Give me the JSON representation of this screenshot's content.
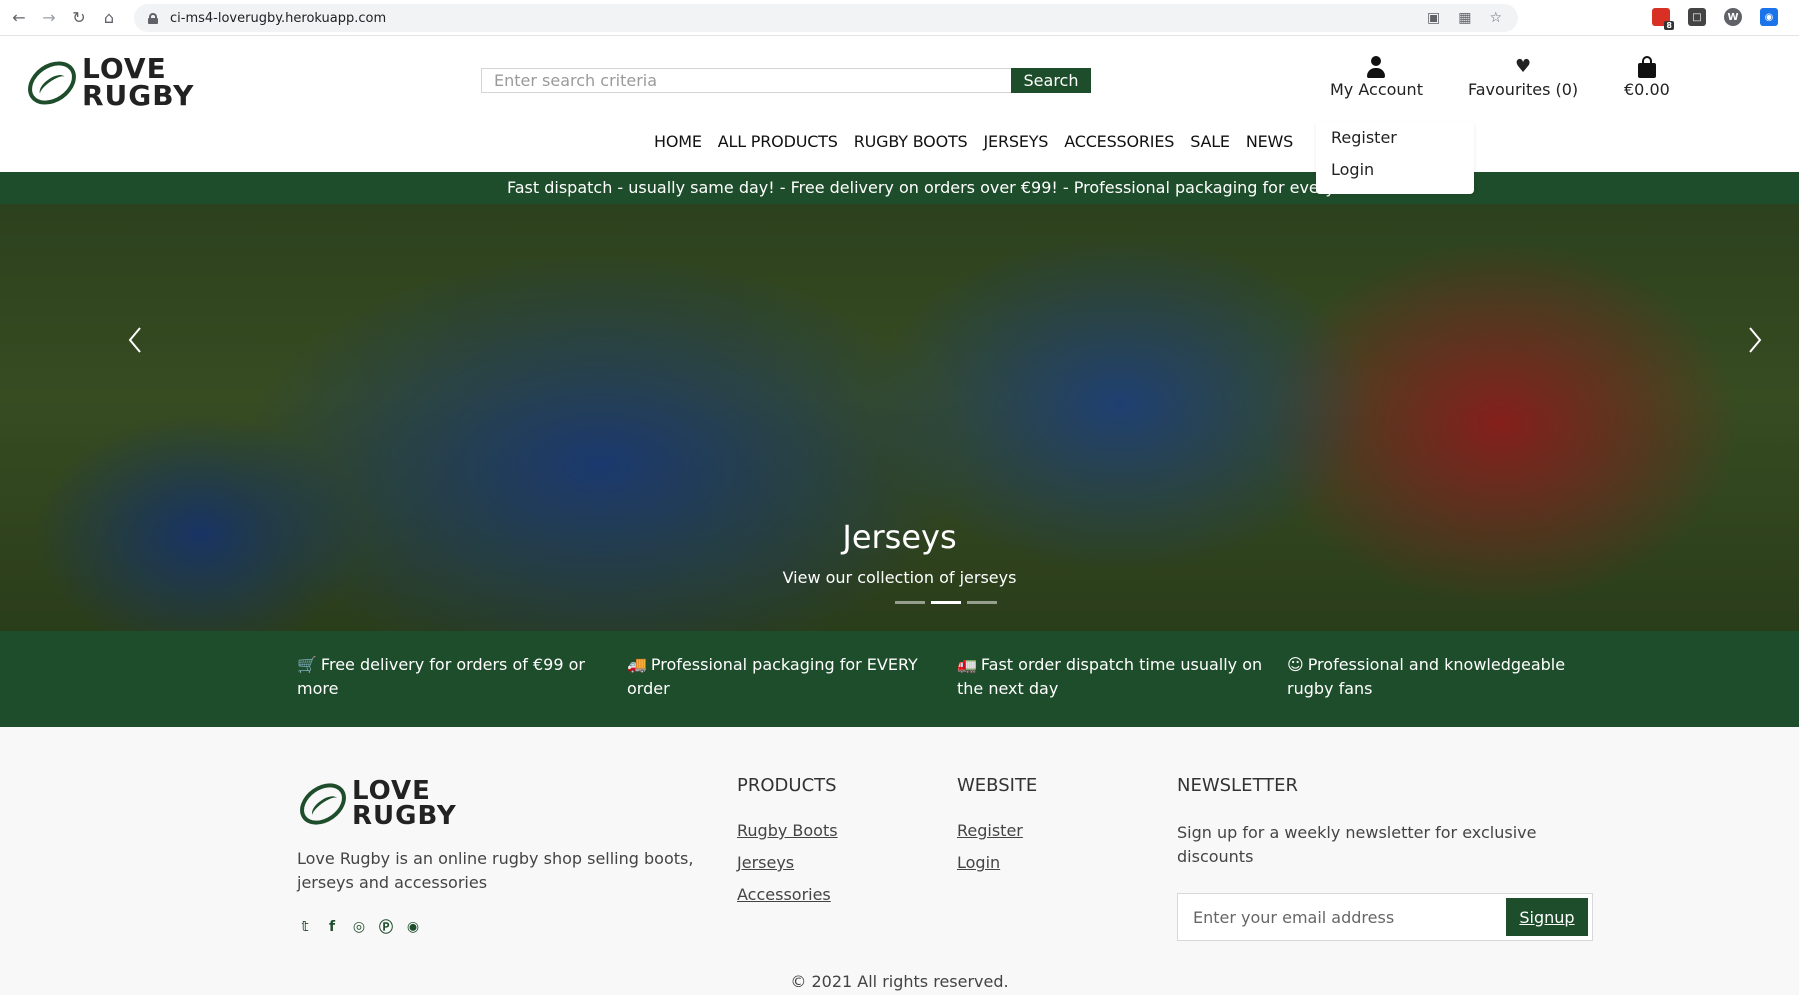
{
  "browser": {
    "url": "ci-ms4-loverugby.herokuapp.com",
    "extension_badge": "8"
  },
  "logo": {
    "line1": "LOVE",
    "line2": "RUGBY"
  },
  "search": {
    "placeholder": "Enter search criteria",
    "button_label": "Search"
  },
  "account": {
    "my_account": "My Account",
    "favourites": "Favourites (0)",
    "cart_total": "€0.00",
    "dropdown": [
      "Register",
      "Login"
    ]
  },
  "nav": [
    "HOME",
    "ALL PRODUCTS",
    "RUGBY BOOTS",
    "JERSEYS",
    "ACCESSORIES",
    "SALE",
    "NEWS"
  ],
  "banner": {
    "text": "Fast dispatch - usually same day! - Free delivery on orders over €99! - Professional packaging for every order!"
  },
  "hero": {
    "title": "Jerseys",
    "subtitle": "View our collection of jerseys",
    "slide_count": 3,
    "active_slide": 2
  },
  "features": [
    {
      "icon": "cart-icon",
      "text": "Free delivery for orders of €99 or more"
    },
    {
      "icon": "box-icon",
      "text": "Professional packaging for EVERY order"
    },
    {
      "icon": "truck-icon",
      "text": "Fast order dispatch time usually on the next day"
    },
    {
      "icon": "smile-icon",
      "text": "Professional and knowledgeable rugby fans"
    }
  ],
  "footer": {
    "description": "Love Rugby is an online rugby shop selling boots, jerseys and accessories",
    "products_title": "PRODUCTS",
    "products_links": [
      "Rugby Boots",
      "Jerseys",
      "Accessories"
    ],
    "website_title": "WEBSITE",
    "website_links": [
      "Register",
      "Login"
    ],
    "newsletter_title": "NEWSLETTER",
    "newsletter_text": "Sign up for a weekly newsletter for exclusive discounts",
    "email_placeholder": "Enter your email address",
    "signup_label": "Signup",
    "copyright": "© 2021 All rights reserved.",
    "social_icons": [
      "twitter-icon",
      "facebook-icon",
      "instagram-icon",
      "pinterest-icon",
      "snapchat-icon"
    ]
  },
  "colors": {
    "brand_green": "#1e4d2b"
  }
}
